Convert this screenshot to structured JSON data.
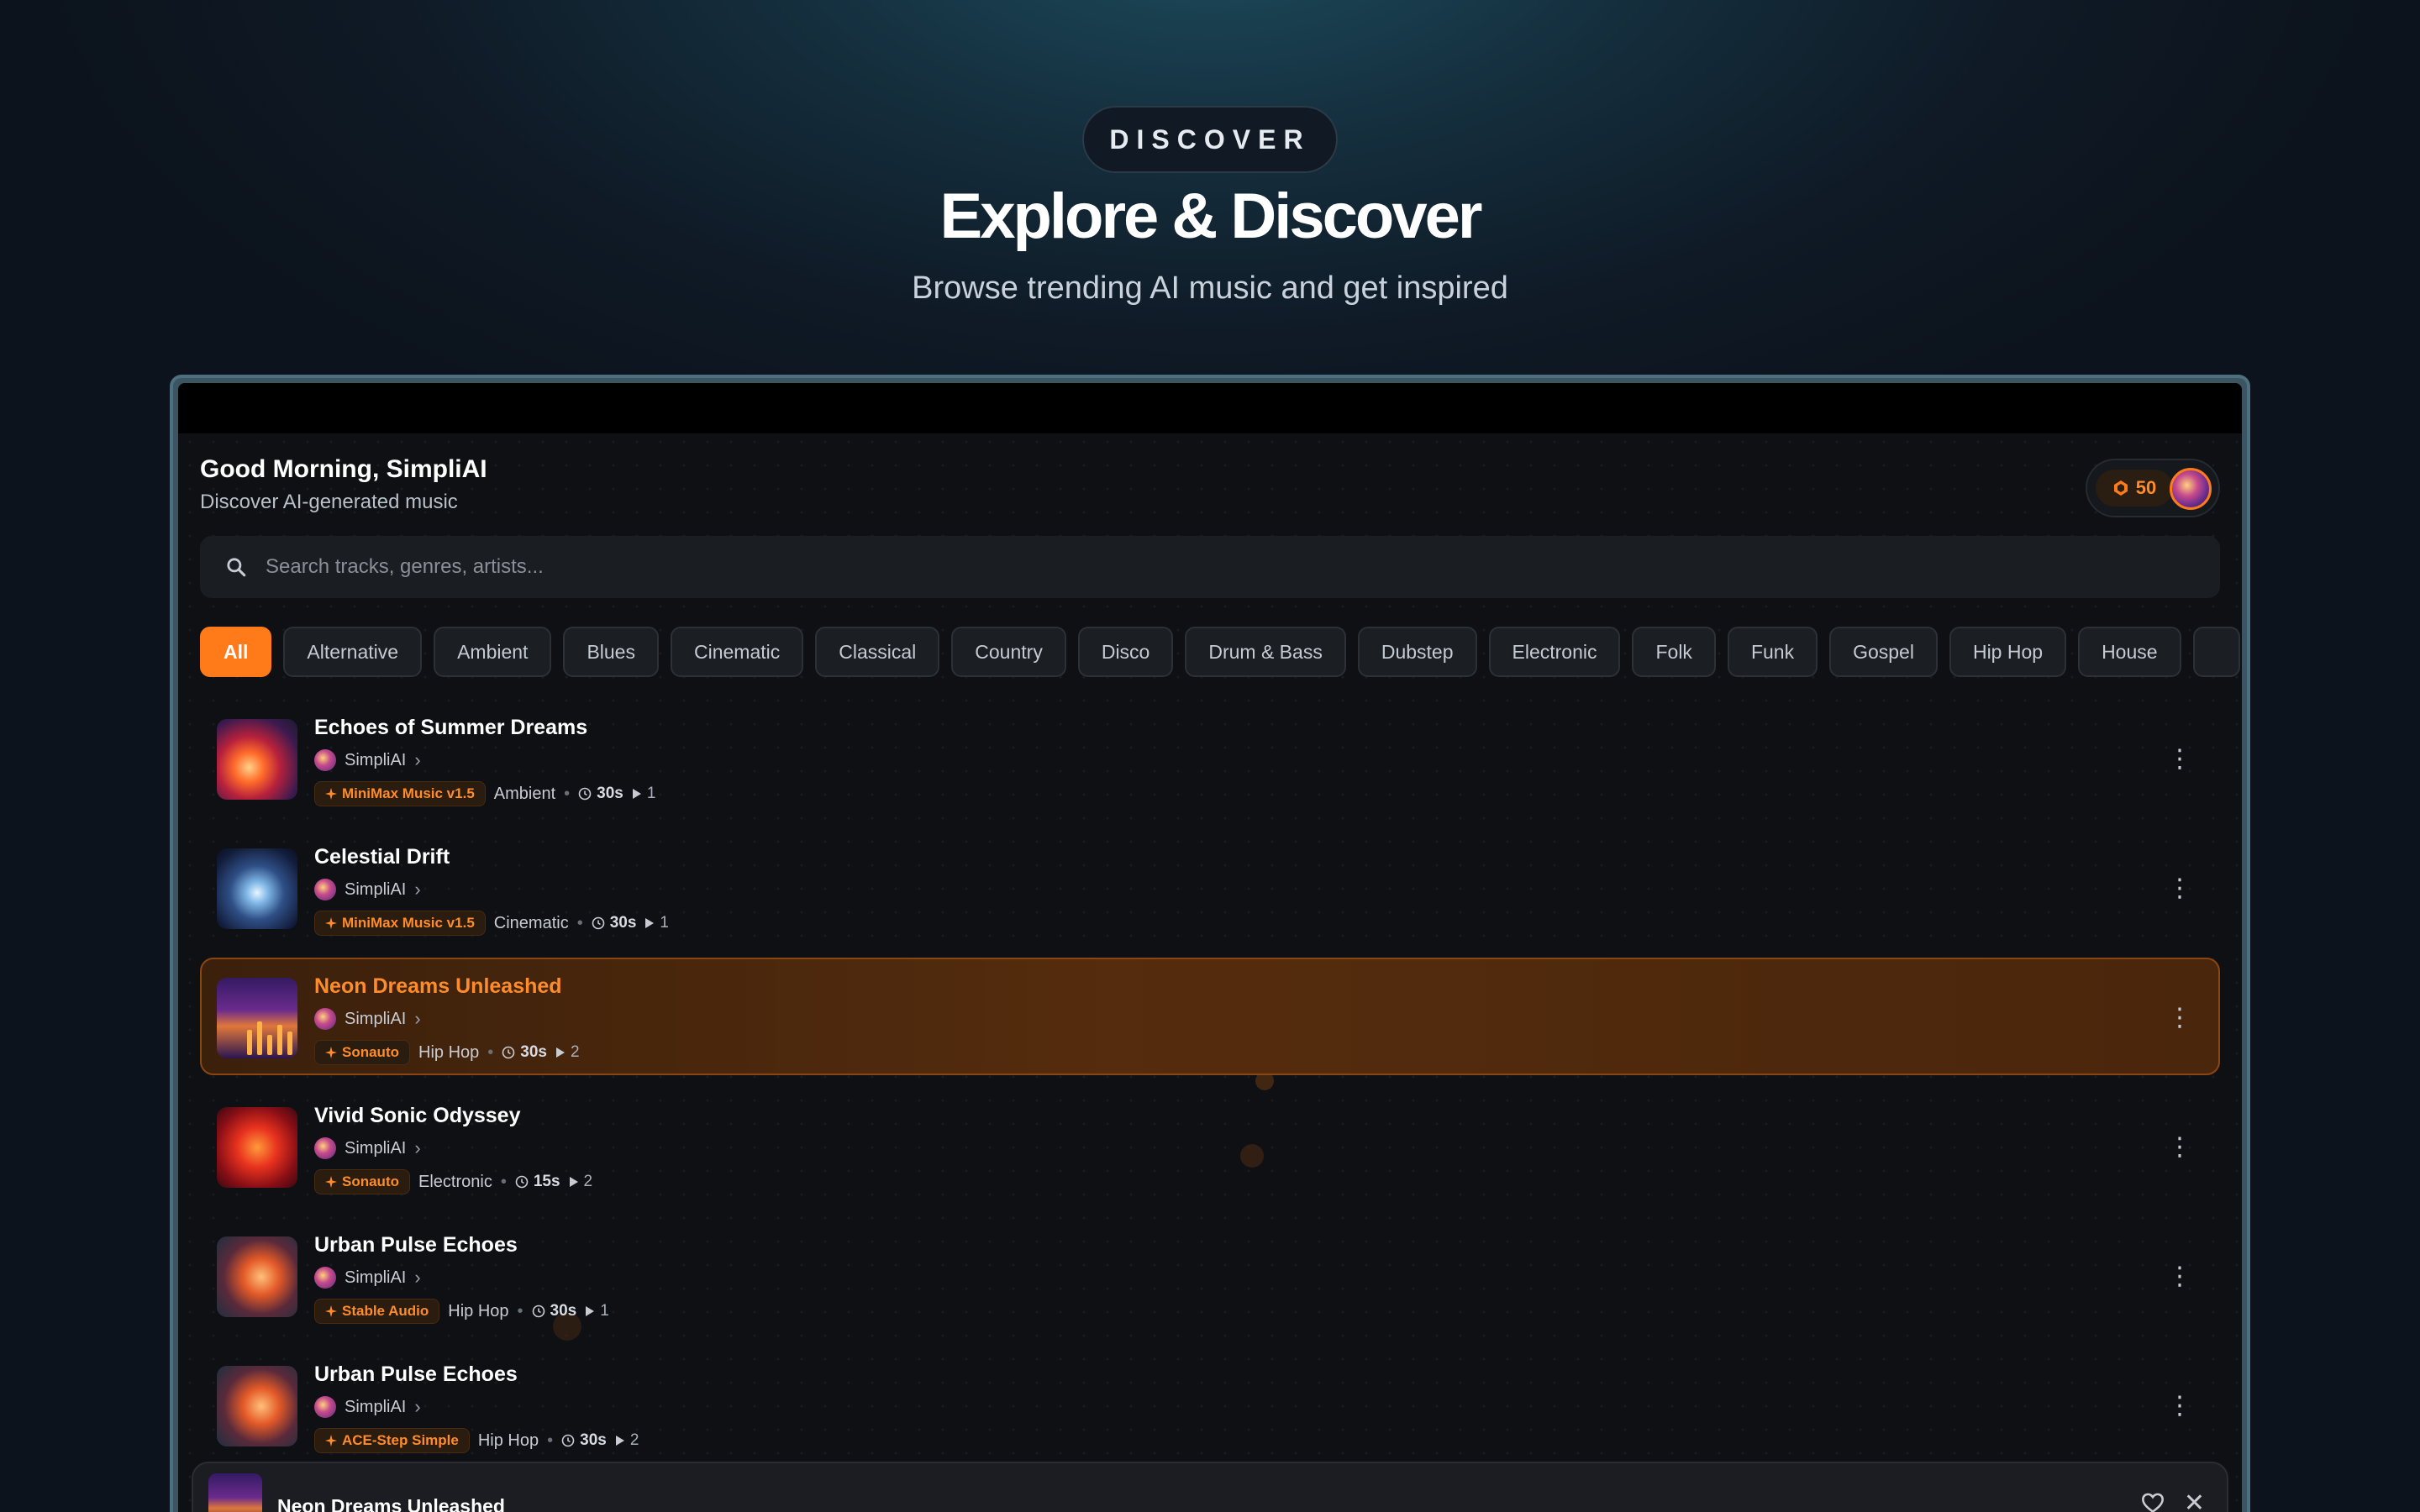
{
  "hero": {
    "badge": "DISCOVER",
    "title": "Explore & Discover",
    "subtitle": "Browse trending AI music and get inspired"
  },
  "app": {
    "greeting": "Good Morning, SimpliAI",
    "greeting_sub": "Discover AI-generated music",
    "credits": "50",
    "search_placeholder": "Search tracks, genres, artists...",
    "genres": [
      "All",
      "Alternative",
      "Ambient",
      "Blues",
      "Cinematic",
      "Classical",
      "Country",
      "Disco",
      "Drum & Bass",
      "Dubstep",
      "Electronic",
      "Folk",
      "Funk",
      "Gospel",
      "Hip Hop",
      "House",
      ""
    ],
    "active_genre": "All",
    "tracks": [
      {
        "title": "Echoes of Summer Dreams",
        "artist": "SimpliAI",
        "model": "MiniMax Music v1.5",
        "genre": "Ambient",
        "duration": "30s",
        "plays": "1"
      },
      {
        "title": "Celestial Drift",
        "artist": "SimpliAI",
        "model": "MiniMax Music v1.5",
        "genre": "Cinematic",
        "duration": "30s",
        "plays": "1"
      },
      {
        "title": "Neon Dreams Unleashed",
        "artist": "SimpliAI",
        "model": "Sonauto",
        "genre": "Hip Hop",
        "duration": "30s",
        "plays": "2"
      },
      {
        "title": "Vivid Sonic Odyssey",
        "artist": "SimpliAI",
        "model": "Sonauto",
        "genre": "Electronic",
        "duration": "15s",
        "plays": "2"
      },
      {
        "title": "Urban Pulse Echoes",
        "artist": "SimpliAI",
        "model": "Stable Audio",
        "genre": "Hip Hop",
        "duration": "30s",
        "plays": "1"
      },
      {
        "title": "Urban Pulse Echoes",
        "artist": "SimpliAI",
        "model": "ACE-Step Simple",
        "genre": "Hip Hop",
        "duration": "30s",
        "plays": "2"
      }
    ],
    "now_playing": {
      "title": "Neon Dreams Unleashed"
    }
  },
  "colors": {
    "accent": "#ff7a18",
    "active_row": "#552c0d"
  },
  "icons": {
    "search": "search-icon",
    "credit": "coin-icon",
    "more": "more-vertical-icon",
    "heart": "heart-icon",
    "close": "close-icon",
    "clock": "clock-icon",
    "play": "play-icon",
    "sparkle": "sparkle-icon"
  }
}
